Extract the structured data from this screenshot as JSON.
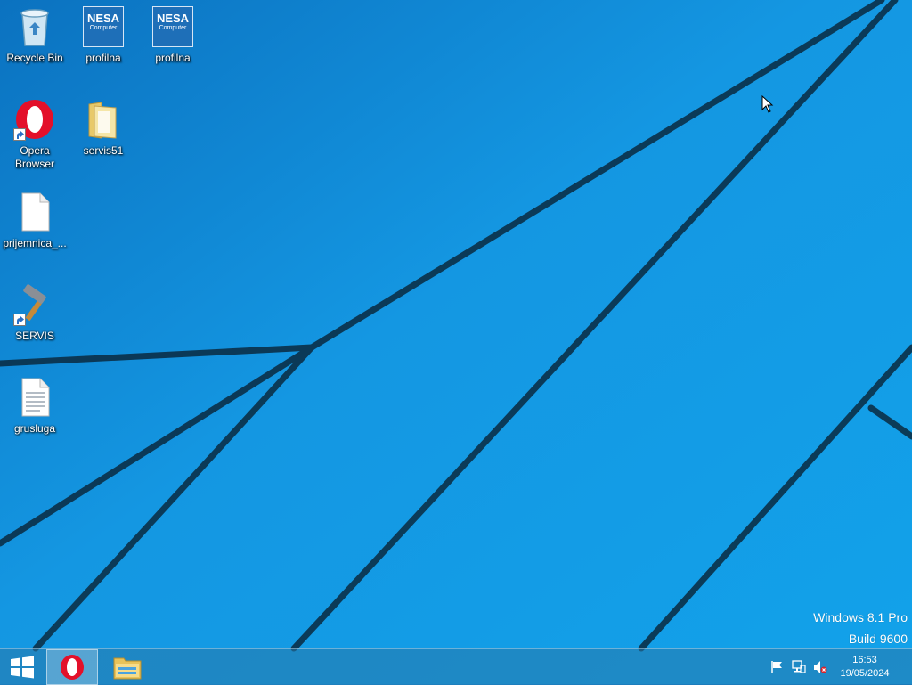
{
  "desktop": {
    "icons": [
      {
        "label": "Recycle Bin",
        "icon": "recycle-bin-icon"
      },
      {
        "label": "profilna",
        "icon": "nesa-computer-icon",
        "brand": "NESA",
        "brand_sub": "Computer"
      },
      {
        "label": "profilna",
        "icon": "nesa-computer-icon",
        "brand": "NESA",
        "brand_sub": "Computer"
      },
      {
        "label": "Opera\nBrowser",
        "icon": "opera-icon"
      },
      {
        "label": "servis51",
        "icon": "folder-icon"
      },
      {
        "label": "prijemnica_...",
        "icon": "file-icon"
      },
      {
        "label": "SERVIS",
        "icon": "hammer-icon"
      },
      {
        "label": "grusluga",
        "icon": "text-file-icon"
      }
    ]
  },
  "watermark": {
    "line1": "Windows 8.1 Pro",
    "line2": "Build 9600"
  },
  "taskbar": {
    "start_icon": "windows-logo-icon",
    "apps": [
      {
        "name": "Opera",
        "icon": "opera-icon",
        "active": true
      },
      {
        "name": "File Explorer",
        "icon": "file-explorer-icon",
        "active": false
      }
    ],
    "tray": {
      "icons": [
        "action-center-flag-icon",
        "network-icon",
        "volume-muted-icon"
      ],
      "time": "16:53",
      "date": "19/05/2024"
    }
  },
  "colors": {
    "background": "#0f84d4",
    "accent_opera": "#e3102a"
  }
}
